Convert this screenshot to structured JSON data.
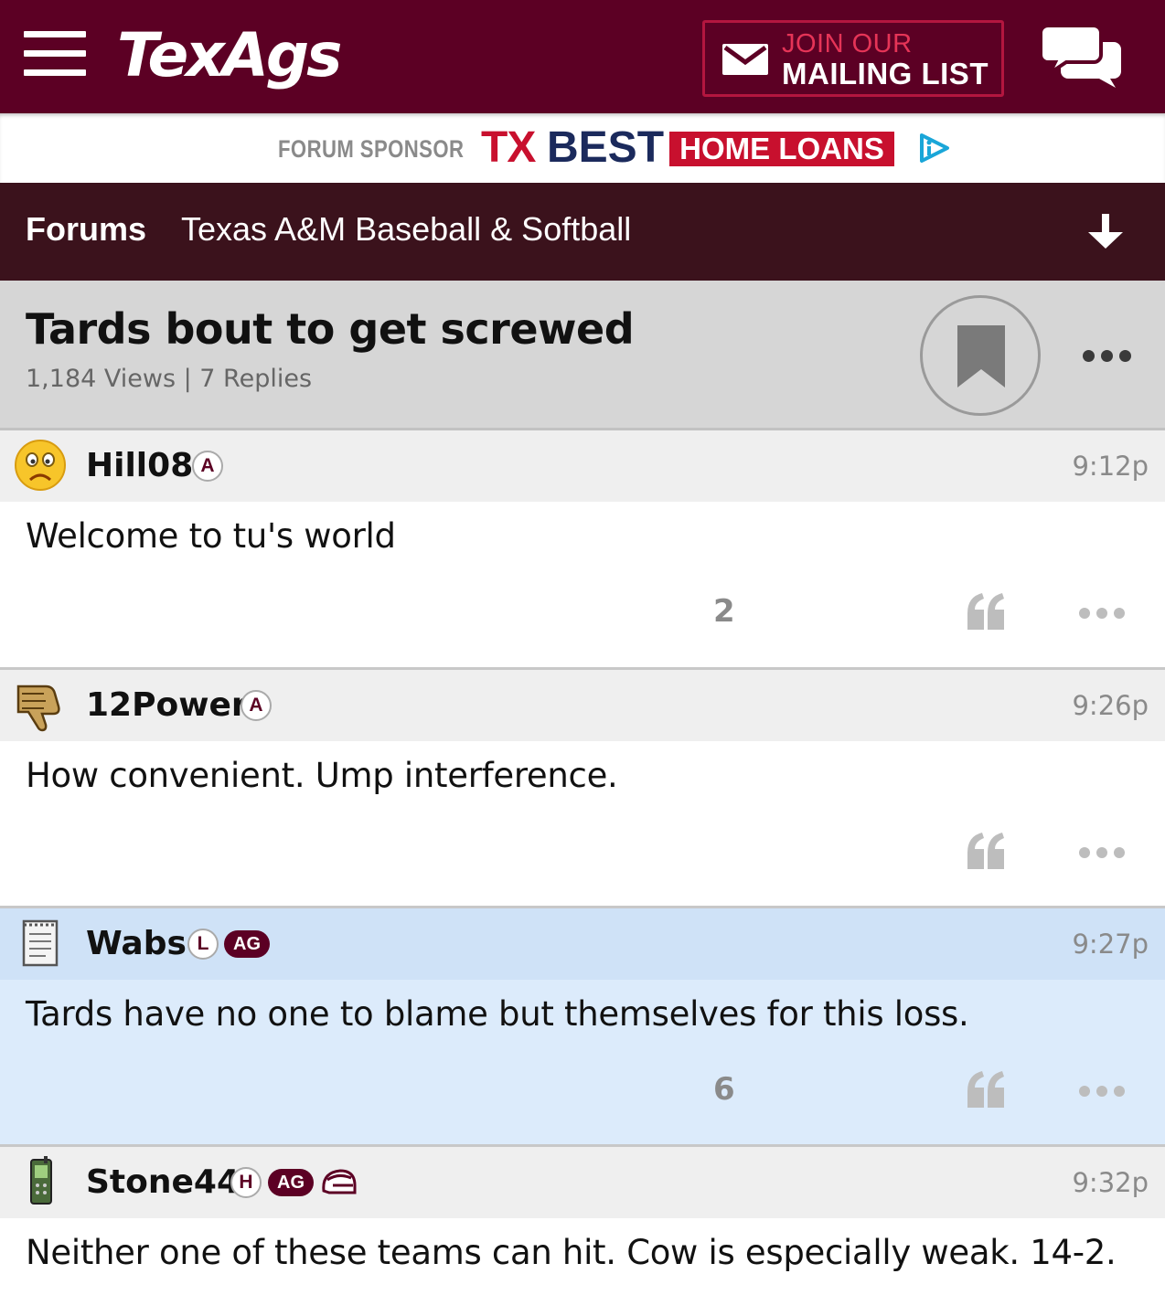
{
  "header": {
    "logo_text": "TexAgs",
    "mailing_line1": "JOIN OUR",
    "mailing_line2": "MAILING LIST",
    "brand_color": "#5c0024",
    "icons": [
      "menu-icon",
      "mail-icon",
      "chat-icon"
    ]
  },
  "sponsor": {
    "label": "FORUM SPONSOR",
    "brand_tx": "TX",
    "brand_best": "BEST",
    "brand_home": "HOME LOANS"
  },
  "forum_nav": {
    "forums_label": "Forums",
    "board_label": "Texas A&M Baseball & Softball"
  },
  "thread": {
    "title": "Tards bout to get screwed",
    "meta": "1,184 Views | 7 Replies"
  },
  "posts": [
    {
      "username": "Hill08",
      "badges": [
        "A"
      ],
      "time": "9:12p",
      "text": "Welcome to tu's world",
      "count": "2",
      "avatar": "sad-face-avatar",
      "highlight": false
    },
    {
      "username": "12Power",
      "badges": [
        "A"
      ],
      "time": "9:26p",
      "text": "How convenient. Ump interference.",
      "count": "",
      "avatar": "thumbs-down-avatar",
      "highlight": false
    },
    {
      "username": "Wabs",
      "badges": [
        "L",
        "AG"
      ],
      "time": "9:27p",
      "text": "Tards have no one to blame but themselves for this loss.",
      "count": "6",
      "avatar": "notepad-avatar",
      "highlight": true
    },
    {
      "username": "Stone44",
      "badges": [
        "H",
        "AG"
      ],
      "time": "9:32p",
      "text": "Neither one of these teams can hit. Cow is especially weak. 14-2.",
      "count": "",
      "avatar": "phone-avatar",
      "highlight": false
    }
  ]
}
